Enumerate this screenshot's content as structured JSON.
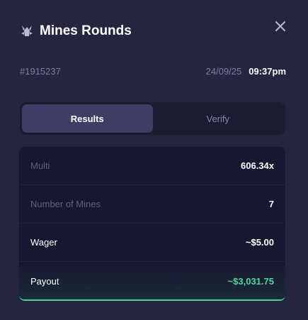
{
  "header": {
    "title": "Mines Rounds"
  },
  "meta": {
    "round_id": "#1915237",
    "date": "24/09/25",
    "time": "09:37pm"
  },
  "tabs": [
    {
      "label": "Results",
      "active": true
    },
    {
      "label": "Verify",
      "active": false
    }
  ],
  "results": [
    {
      "label": "Multi",
      "value": "606.34x"
    },
    {
      "label": "Number of Mines",
      "value": "7"
    },
    {
      "label": "Wager",
      "value": "~$5.00"
    },
    {
      "label": "Payout",
      "value": "~$3,031.75"
    }
  ],
  "colors": {
    "background": "#25253f",
    "panel": "#171730",
    "tab_active": "#3d3d66",
    "payout_green": "#4cd99e",
    "muted_text": "#5f5f82"
  },
  "icons": {
    "header": "mines-icon",
    "close": "close-icon"
  }
}
